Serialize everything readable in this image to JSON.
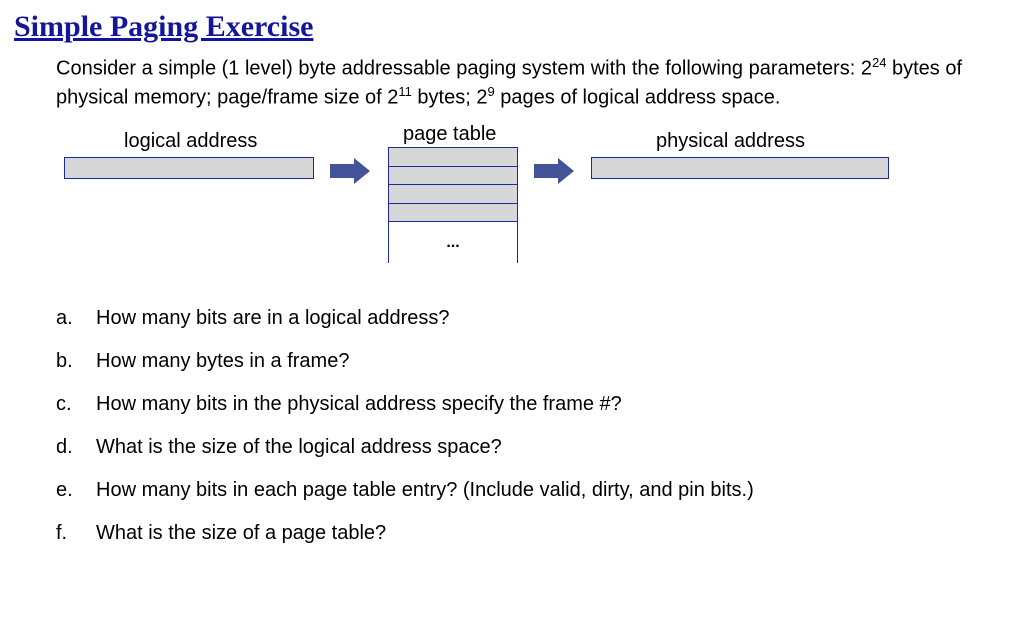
{
  "title": "Simple Paging Exercise",
  "description": {
    "pre": "Consider a simple (1 level) byte addressable paging system with the following parameters: 2",
    "exp1": "24",
    "mid1": " bytes of physical memory; page/frame size of 2",
    "exp2": "11",
    "mid2": " bytes; 2",
    "exp3": "9",
    "post": " pages of logical address space."
  },
  "diagram": {
    "logical_label": "logical address",
    "page_table_label": "page table",
    "physical_label": "physical address",
    "ellipsis": "..."
  },
  "questions": [
    {
      "label": "a.",
      "text": "How many bits are in a logical address?"
    },
    {
      "label": "b.",
      "text": "How many bytes in a frame?"
    },
    {
      "label": "c.",
      "text": "How many bits in the physical address specify the frame #?"
    },
    {
      "label": "d.",
      "text": "What is the size of the logical address space?"
    },
    {
      "label": "e.",
      "text": "How many bits in each page table entry?  (Include valid, dirty, and pin bits.)"
    },
    {
      "label": "f.",
      "text": "What is the size of a page table?"
    }
  ]
}
